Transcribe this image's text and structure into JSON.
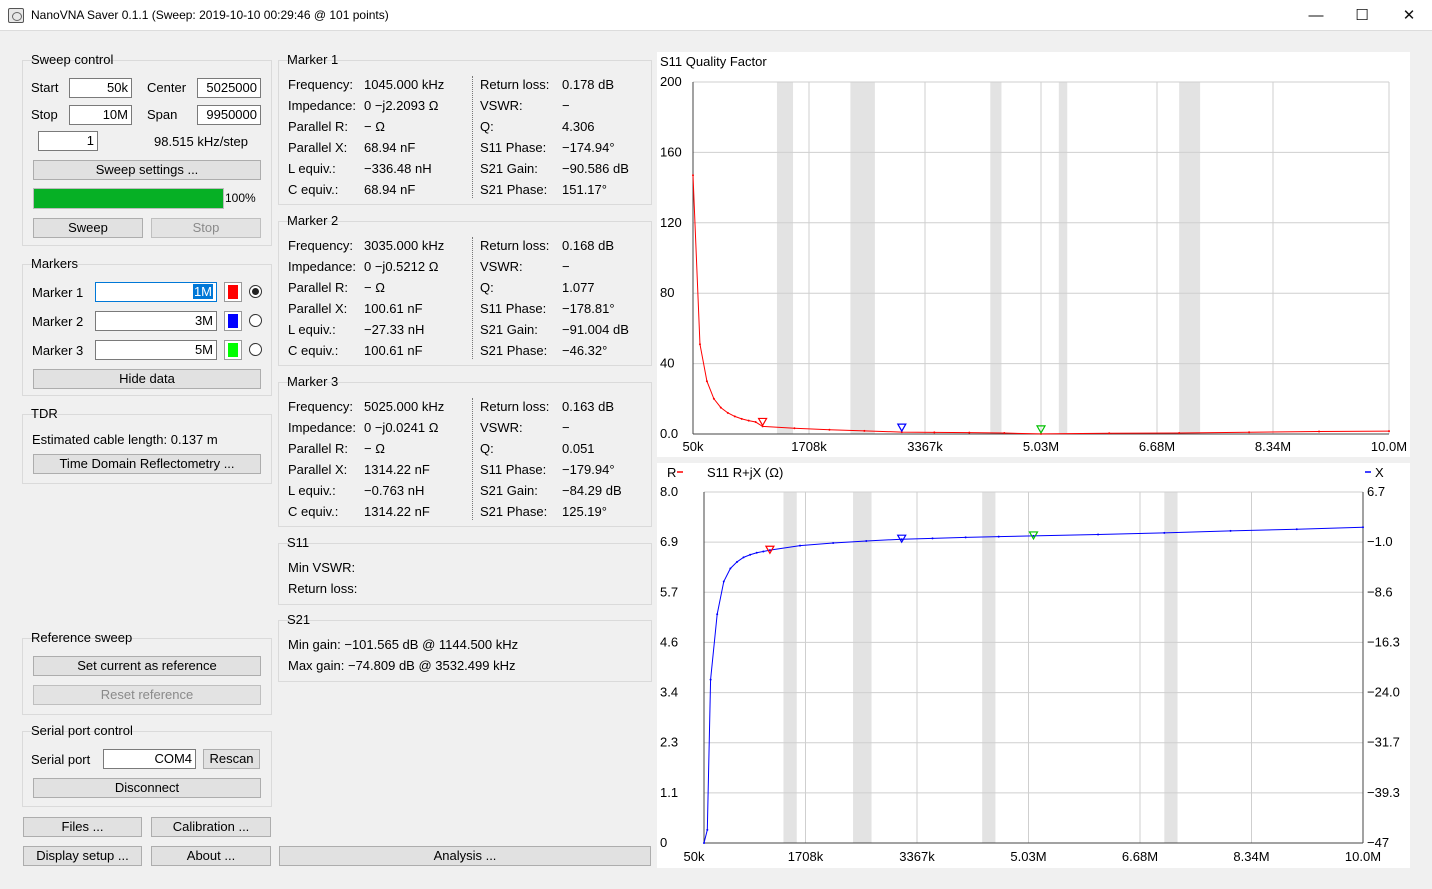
{
  "window": {
    "title": "NanoVNA Saver 0.1.1 (Sweep: 2019-10-10 00:29:46 @ 101 points)",
    "minimize": "—",
    "maximize": "☐",
    "close": "✕"
  },
  "sweep_control": {
    "title": "Sweep control",
    "start_label": "Start",
    "start_value": "50k",
    "center_label": "Center",
    "center_value": "5025000",
    "stop_label": "Stop",
    "stop_value": "10M",
    "span_label": "Span",
    "span_value": "9950000",
    "segments_value": "1",
    "step_text": "98.515 kHz/step",
    "settings_button": "Sweep settings ...",
    "progress_percent": 100,
    "progress_text": "100%",
    "sweep_button": "Sweep",
    "stop_button": "Stop"
  },
  "markers": {
    "title": "Markers",
    "items": [
      {
        "label": "Marker 1",
        "value": "1M",
        "color": "#ff0000",
        "selected": true
      },
      {
        "label": "Marker 2",
        "value": "3M",
        "color": "#0000ff",
        "selected": false
      },
      {
        "label": "Marker 3",
        "value": "5M",
        "color": "#00ff00",
        "selected": false
      }
    ],
    "hide_button": "Hide data"
  },
  "tdr": {
    "title": "TDR",
    "cable_text": "Estimated cable length: 0.137 m",
    "button": "Time Domain Reflectometry ..."
  },
  "reference": {
    "title": "Reference sweep",
    "set_button": "Set current as reference",
    "reset_button": "Reset reference"
  },
  "serial": {
    "title": "Serial port control",
    "port_label": "Serial port",
    "port_value": "COM4",
    "rescan_button": "Rescan",
    "disconnect_button": "Disconnect"
  },
  "bottom_buttons": {
    "files": "Files ...",
    "calibration": "Calibration ...",
    "display": "Display setup ...",
    "about": "About ...",
    "analysis": "Analysis ..."
  },
  "marker_details": [
    {
      "title": "Marker 1",
      "left": [
        {
          "label": "Frequency:",
          "value": "1045.000 kHz"
        },
        {
          "label": "Impedance:",
          "value": "0 −j2.2093 Ω"
        },
        {
          "label": "Parallel R:",
          "value": "− Ω"
        },
        {
          "label": "Parallel X:",
          "value": "68.94 nF"
        },
        {
          "label": "L equiv.:",
          "value": "−336.48 nH"
        },
        {
          "label": "C equiv.:",
          "value": "68.94 nF"
        }
      ],
      "right": [
        {
          "label": "Return loss:",
          "value": "0.178 dB"
        },
        {
          "label": "VSWR:",
          "value": "−"
        },
        {
          "label": "Q:",
          "value": "4.306"
        },
        {
          "label": "S11 Phase:",
          "value": "−174.94°"
        },
        {
          "label": "S21 Gain:",
          "value": "−90.586 dB"
        },
        {
          "label": "S21 Phase:",
          "value": "151.17°"
        }
      ]
    },
    {
      "title": "Marker 2",
      "left": [
        {
          "label": "Frequency:",
          "value": "3035.000 kHz"
        },
        {
          "label": "Impedance:",
          "value": "0 −j0.5212 Ω"
        },
        {
          "label": "Parallel R:",
          "value": "− Ω"
        },
        {
          "label": "Parallel X:",
          "value": "100.61 nF"
        },
        {
          "label": "L equiv.:",
          "value": "−27.33 nH"
        },
        {
          "label": "C equiv.:",
          "value": "100.61 nF"
        }
      ],
      "right": [
        {
          "label": "Return loss:",
          "value": "0.168 dB"
        },
        {
          "label": "VSWR:",
          "value": "−"
        },
        {
          "label": "Q:",
          "value": "1.077"
        },
        {
          "label": "S11 Phase:",
          "value": "−178.81°"
        },
        {
          "label": "S21 Gain:",
          "value": "−91.004 dB"
        },
        {
          "label": "S21 Phase:",
          "value": "−46.32°"
        }
      ]
    },
    {
      "title": "Marker 3",
      "left": [
        {
          "label": "Frequency:",
          "value": "5025.000 kHz"
        },
        {
          "label": "Impedance:",
          "value": "0 −j0.0241 Ω"
        },
        {
          "label": "Parallel R:",
          "value": "− Ω"
        },
        {
          "label": "Parallel X:",
          "value": "1314.22 nF"
        },
        {
          "label": "L equiv.:",
          "value": "−0.763 nH"
        },
        {
          "label": "C equiv.:",
          "value": "1314.22 nF"
        }
      ],
      "right": [
        {
          "label": "Return loss:",
          "value": "0.163 dB"
        },
        {
          "label": "VSWR:",
          "value": "−"
        },
        {
          "label": "Q:",
          "value": "0.051"
        },
        {
          "label": "S11 Phase:",
          "value": "−179.94°"
        },
        {
          "label": "S21 Gain:",
          "value": "−84.29 dB"
        },
        {
          "label": "S21 Phase:",
          "value": "125.19°"
        }
      ]
    }
  ],
  "s11_summary": {
    "title": "S11",
    "min_vswr_label": "Min VSWR:",
    "return_loss_label": "Return loss:"
  },
  "s21_summary": {
    "title": "S21",
    "min_gain": "Min gain:  −101.565 dB @ 1144.500 kHz",
    "max_gain": "Max gain:  −74.809 dB @ 3532.499 kHz"
  },
  "chart_data": [
    {
      "type": "line",
      "title": "S11  Quality Factor",
      "x_tick_labels": [
        "50k",
        "1708k",
        "3367k",
        "5.03M",
        "6.68M",
        "8.34M",
        "10.0M"
      ],
      "y_tick_labels": [
        "200",
        "160",
        "120",
        "80",
        "40",
        "0.0"
      ],
      "x_range_hz": [
        50000,
        10000000
      ],
      "ylim": [
        0,
        200
      ],
      "grid": true,
      "band_colors": "#e3e3e3",
      "bands_hz": [
        [
          1250000,
          1480000
        ],
        [
          2300000,
          2650000
        ],
        [
          4300000,
          4460000
        ],
        [
          5280000,
          5400000
        ],
        [
          7000000,
          7300000
        ]
      ],
      "series": [
        {
          "color": "#ff0000",
          "points": [
            [
              50000,
              147
            ],
            [
              149500,
              51
            ],
            [
              249000,
              30
            ],
            [
              348500,
              20
            ],
            [
              448000,
              15
            ],
            [
              547500,
              12
            ],
            [
              647000,
              10
            ],
            [
              746500,
              8.6
            ],
            [
              846000,
              7.6
            ],
            [
              945500,
              6.8
            ],
            [
              1045000,
              4.3
            ],
            [
              1500000,
              3.3
            ],
            [
              2000000,
              2.4
            ],
            [
              2500000,
              1.8
            ],
            [
              3035000,
              1.08
            ],
            [
              3500000,
              0.95
            ],
            [
              4000000,
              0.75
            ],
            [
              4500000,
              0.55
            ],
            [
              5025000,
              0.05
            ],
            [
              6000000,
              0.4
            ],
            [
              7000000,
              0.6
            ],
            [
              8000000,
              1.0
            ],
            [
              9000000,
              1.4
            ],
            [
              10000000,
              1.6
            ]
          ]
        }
      ],
      "markers": [
        {
          "x": 1045000,
          "y": 4.306,
          "color": "#ff0000"
        },
        {
          "x": 3035000,
          "y": 1.077,
          "color": "#0000ff"
        },
        {
          "x": 5025000,
          "y": 0.051,
          "color": "#00c000"
        }
      ]
    },
    {
      "type": "line",
      "title": "S11  R+jX (Ω)",
      "legend_left": "R",
      "legend_right": "X",
      "legend_left_color": "#ff0000",
      "legend_right_color": "#0000ff",
      "x_tick_labels": [
        "50k",
        "1708k",
        "3367k",
        "5.03M",
        "6.68M",
        "8.34M",
        "10.0M"
      ],
      "y_left_tick_labels": [
        "8.0",
        "6.9",
        "5.7",
        "4.6",
        "3.4",
        "2.3",
        "1.1",
        "0"
      ],
      "y_right_tick_labels": [
        "6.7",
        "−1.0",
        "−8.6",
        "−16.3",
        "−24.0",
        "−31.7",
        "−39.3",
        "−47"
      ],
      "x_range_hz": [
        50000,
        10000000
      ],
      "y_right_range": [
        -47,
        6.7
      ],
      "grid": true,
      "bands_hz": [
        [
          1250000,
          1450000
        ],
        [
          2300000,
          2580000
        ],
        [
          4250000,
          4450000
        ],
        [
          7000000,
          7200000
        ]
      ],
      "series": [
        {
          "name": "X",
          "color": "#0000ff",
          "points": [
            [
              50000,
              -47
            ],
            [
              100000,
              -45
            ],
            [
              149500,
              -22
            ],
            [
              249000,
              -12
            ],
            [
              348500,
              -7
            ],
            [
              448000,
              -5
            ],
            [
              547500,
              -4
            ],
            [
              647000,
              -3.3
            ],
            [
              746500,
              -2.9
            ],
            [
              846000,
              -2.6
            ],
            [
              945500,
              -2.4
            ],
            [
              1045000,
              -2.2
            ],
            [
              1500000,
              -1.5
            ],
            [
              2000000,
              -1.1
            ],
            [
              2500000,
              -0.8
            ],
            [
              3035000,
              -0.52
            ],
            [
              3500000,
              -0.4
            ],
            [
              4000000,
              -0.25
            ],
            [
              4500000,
              -0.12
            ],
            [
              5025000,
              -0.02
            ],
            [
              6000000,
              0.2
            ],
            [
              7000000,
              0.45
            ],
            [
              8000000,
              0.75
            ],
            [
              9000000,
              1.0
            ],
            [
              10000000,
              1.3
            ]
          ]
        }
      ],
      "markers": [
        {
          "x": 1045000,
          "y": -2.2093,
          "color": "#ff0000"
        },
        {
          "x": 3035000,
          "y": -0.5212,
          "color": "#0000ff"
        },
        {
          "x": 5025000,
          "y": -0.0241,
          "color": "#00c000"
        }
      ]
    }
  ]
}
